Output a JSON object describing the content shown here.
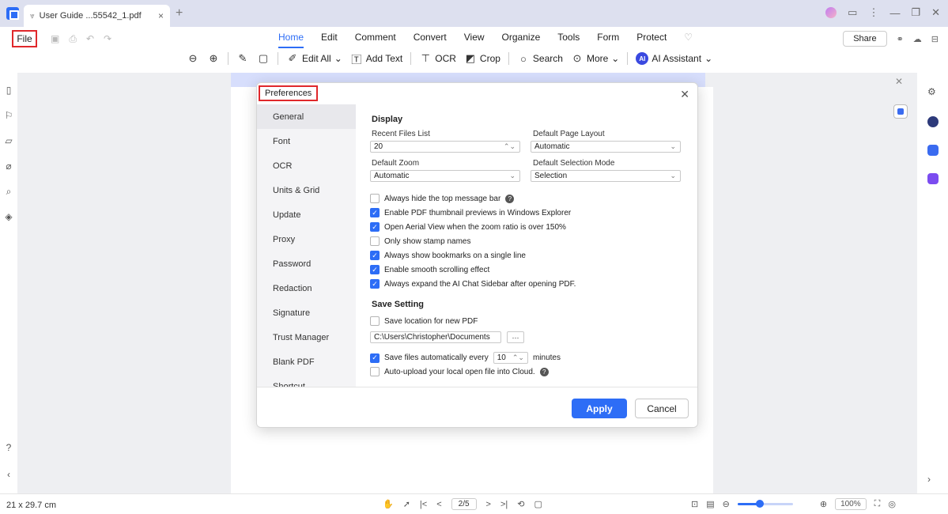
{
  "titlebar": {
    "tab_title": "User Guide ...55542_1.pdf",
    "close": "×",
    "new_tab": "+"
  },
  "menubar": {
    "file": "File",
    "tabs": [
      "Home",
      "Edit",
      "Comment",
      "Convert",
      "View",
      "Organize",
      "Tools",
      "Form",
      "Protect"
    ],
    "active_tab": "Home",
    "share": "Share"
  },
  "toolbar": {
    "edit_all": "Edit All",
    "add_text": "Add Text",
    "ocr": "OCR",
    "crop": "Crop",
    "search": "Search",
    "more": "More",
    "ai_assistant": "AI Assistant",
    "ai_badge": "AI"
  },
  "dialog": {
    "title": "Preferences",
    "nav_items": [
      "General",
      "Font",
      "OCR",
      "Units & Grid",
      "Update",
      "Proxy",
      "Password",
      "Redaction",
      "Signature",
      "Trust Manager",
      "Blank PDF",
      "Shortcut"
    ],
    "active_nav": "General",
    "display_title": "Display",
    "recent_files_label": "Recent Files List",
    "recent_files_value": "20",
    "page_layout_label": "Default Page Layout",
    "page_layout_value": "Automatic",
    "zoom_label": "Default Zoom",
    "zoom_value": "Automatic",
    "selection_mode_label": "Default Selection Mode",
    "selection_mode_value": "Selection",
    "options": [
      {
        "label": "Always hide the top message bar",
        "checked": false
      },
      {
        "label": "Enable PDF thumbnail previews in Windows Explorer",
        "checked": true
      },
      {
        "label": "Open Aerial View when the zoom ratio is over 150%",
        "checked": true
      },
      {
        "label": "Only show stamp names",
        "checked": false
      },
      {
        "label": "Always show bookmarks on a single line",
        "checked": true
      },
      {
        "label": "Enable smooth scrolling effect",
        "checked": true
      },
      {
        "label": "Always expand the AI Chat Sidebar after opening PDF.",
        "checked": true
      }
    ],
    "save_title": "Save Setting",
    "save_location_label": "Save location for new PDF",
    "save_path": "C:\\Users\\Christopher\\Documents",
    "dots": "···",
    "autosave_prefix": "Save files automatically every",
    "autosave_value": "10",
    "autosave_suffix": "minutes",
    "autoupload_label": "Auto-upload your local open file into Cloud.",
    "apply": "Apply",
    "cancel": "Cancel"
  },
  "statusbar": {
    "page_size": "21 x 29.7 cm",
    "page_indicator": "2/5",
    "zoom": "100%",
    "zoom_fraction": 0.4
  },
  "colors": {
    "accent": "#2d6df6",
    "highlight_border": "#e0282b"
  }
}
